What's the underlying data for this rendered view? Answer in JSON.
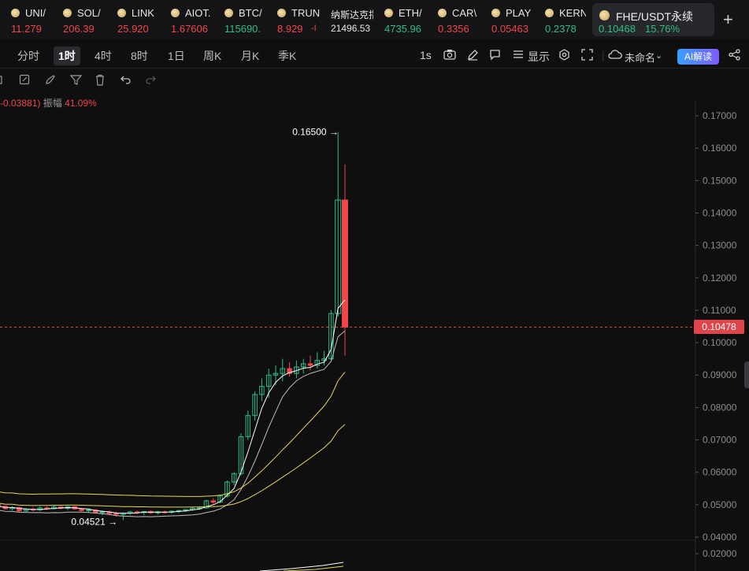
{
  "ticker": {
    "items": [
      {
        "symbol": "UNI/",
        "price": "11.279",
        "trend": "dn"
      },
      {
        "symbol": "SOL/",
        "price": "206.39",
        "trend": "dn"
      },
      {
        "symbol": "LINK",
        "price": "25.920",
        "trend": "dn"
      },
      {
        "symbol": "AIOT.",
        "price": "1.67606",
        "trend": "dn"
      },
      {
        "symbol": "BTC/",
        "price": "115690.",
        "trend": "up"
      },
      {
        "symbol": "TRUN",
        "price": "8.929",
        "extra": "-I",
        "trend": "dn"
      },
      {
        "symbol": "纳斯达克指",
        "price": "21496.53",
        "trend": "wt"
      },
      {
        "symbol": "ETH/",
        "price": "4735.96",
        "trend": "up"
      },
      {
        "symbol": "CAR\\",
        "price": "0.3356",
        "trend": "dn"
      },
      {
        "symbol": "PLAY",
        "price": "0.05463",
        "trend": "dn"
      },
      {
        "symbol": "KERN",
        "price": "0.2378",
        "trend": "up"
      }
    ],
    "active": {
      "symbol": "FHE/USDT永续",
      "price": "0.10468",
      "change": "15.76%"
    },
    "add_label": "+"
  },
  "intervals": {
    "items": [
      "分时",
      "1时",
      "4时",
      "8时",
      "1日",
      "周K",
      "月K",
      "季K"
    ],
    "active_index": 1
  },
  "toolbar": {
    "speed": "1s",
    "display": "显示",
    "layout_name": "未命名",
    "ai_label": "AI解读"
  },
  "stats": {
    "change": "-0.03881)",
    "amplitude_label": "振幅",
    "amplitude_value": "41.09%"
  },
  "price_axis": {
    "ticks": [
      "0.17000",
      "0.16000",
      "0.15000",
      "0.14000",
      "0.13000",
      "0.12000",
      "0.11000",
      "0.10000",
      "0.09000",
      "0.08000",
      "0.07000",
      "0.06000",
      "0.05000",
      "0.04000",
      "0.02000"
    ],
    "current_price": "0.10478"
  },
  "chart_data": {
    "type": "candlestick",
    "high_label": "0.16500",
    "low_label": "0.04521",
    "last_price": 0.10478,
    "colors": {
      "up": "#2ebd85",
      "down": "#f0454b",
      "ma_fast": "#ffffff",
      "ma_slow1": "#e6d65a",
      "ma_slow2": "#e6d65a"
    },
    "candles": [
      [
        0.05,
        0.0502,
        0.0492,
        0.0495
      ],
      [
        0.0495,
        0.0497,
        0.0485,
        0.0488
      ],
      [
        0.0488,
        0.0496,
        0.0482,
        0.0491
      ],
      [
        0.0491,
        0.0494,
        0.0478,
        0.0481
      ],
      [
        0.0481,
        0.049,
        0.0476,
        0.0486
      ],
      [
        0.0486,
        0.0491,
        0.048,
        0.0484
      ],
      [
        0.0484,
        0.0495,
        0.0481,
        0.049
      ],
      [
        0.049,
        0.0495,
        0.0484,
        0.0488
      ],
      [
        0.0488,
        0.0498,
        0.0485,
        0.0493
      ],
      [
        0.0493,
        0.0496,
        0.0486,
        0.0489
      ],
      [
        0.0489,
        0.0497,
        0.0484,
        0.0494
      ],
      [
        0.0494,
        0.0496,
        0.0485,
        0.0487
      ],
      [
        0.0487,
        0.049,
        0.0479,
        0.0482
      ],
      [
        0.0482,
        0.0488,
        0.0475,
        0.0484
      ],
      [
        0.0484,
        0.0486,
        0.0473,
        0.0476
      ],
      [
        0.0476,
        0.0481,
        0.0467,
        0.0478
      ],
      [
        0.0478,
        0.0482,
        0.0469,
        0.0473
      ],
      [
        0.0473,
        0.0478,
        0.0463,
        0.047
      ],
      [
        0.047,
        0.0476,
        0.0452,
        0.0474
      ],
      [
        0.0474,
        0.0481,
        0.0469,
        0.0478
      ],
      [
        0.0478,
        0.0482,
        0.0471,
        0.0476
      ],
      [
        0.0476,
        0.048,
        0.0468,
        0.0479
      ],
      [
        0.0479,
        0.0483,
        0.0472,
        0.0475
      ],
      [
        0.0475,
        0.0481,
        0.047,
        0.0478
      ],
      [
        0.0478,
        0.0482,
        0.0473,
        0.0477
      ],
      [
        0.0477,
        0.0483,
        0.0472,
        0.048
      ],
      [
        0.048,
        0.0484,
        0.0474,
        0.0482
      ],
      [
        0.0482,
        0.0487,
        0.0478,
        0.0485
      ],
      [
        0.0485,
        0.0492,
        0.0481,
        0.0489
      ],
      [
        0.0489,
        0.0495,
        0.0484,
        0.049
      ],
      [
        0.049,
        0.0515,
        0.0488,
        0.0512
      ],
      [
        0.0512,
        0.052,
        0.0503,
        0.0508
      ],
      [
        0.0508,
        0.053,
        0.0505,
        0.0527
      ],
      [
        0.0527,
        0.0575,
        0.0522,
        0.057
      ],
      [
        0.057,
        0.06,
        0.056,
        0.0596
      ],
      [
        0.0596,
        0.072,
        0.059,
        0.071
      ],
      [
        0.071,
        0.079,
        0.07,
        0.0775
      ],
      [
        0.0775,
        0.085,
        0.076,
        0.084
      ],
      [
        0.084,
        0.089,
        0.082,
        0.0865
      ],
      [
        0.0865,
        0.092,
        0.083,
        0.09
      ],
      [
        0.09,
        0.093,
        0.087,
        0.0905
      ],
      [
        0.0905,
        0.095,
        0.088,
        0.092
      ],
      [
        0.092,
        0.094,
        0.0895,
        0.0905
      ],
      [
        0.0905,
        0.0945,
        0.089,
        0.0925
      ],
      [
        0.0925,
        0.095,
        0.0905,
        0.0935
      ],
      [
        0.0935,
        0.096,
        0.0915,
        0.093
      ],
      [
        0.093,
        0.097,
        0.092,
        0.0945
      ],
      [
        0.0945,
        0.0975,
        0.093,
        0.095
      ],
      [
        0.095,
        0.11,
        0.0945,
        0.109
      ],
      [
        0.109,
        0.165,
        0.108,
        0.144
      ],
      [
        0.144,
        0.155,
        0.096,
        0.1048
      ]
    ]
  }
}
